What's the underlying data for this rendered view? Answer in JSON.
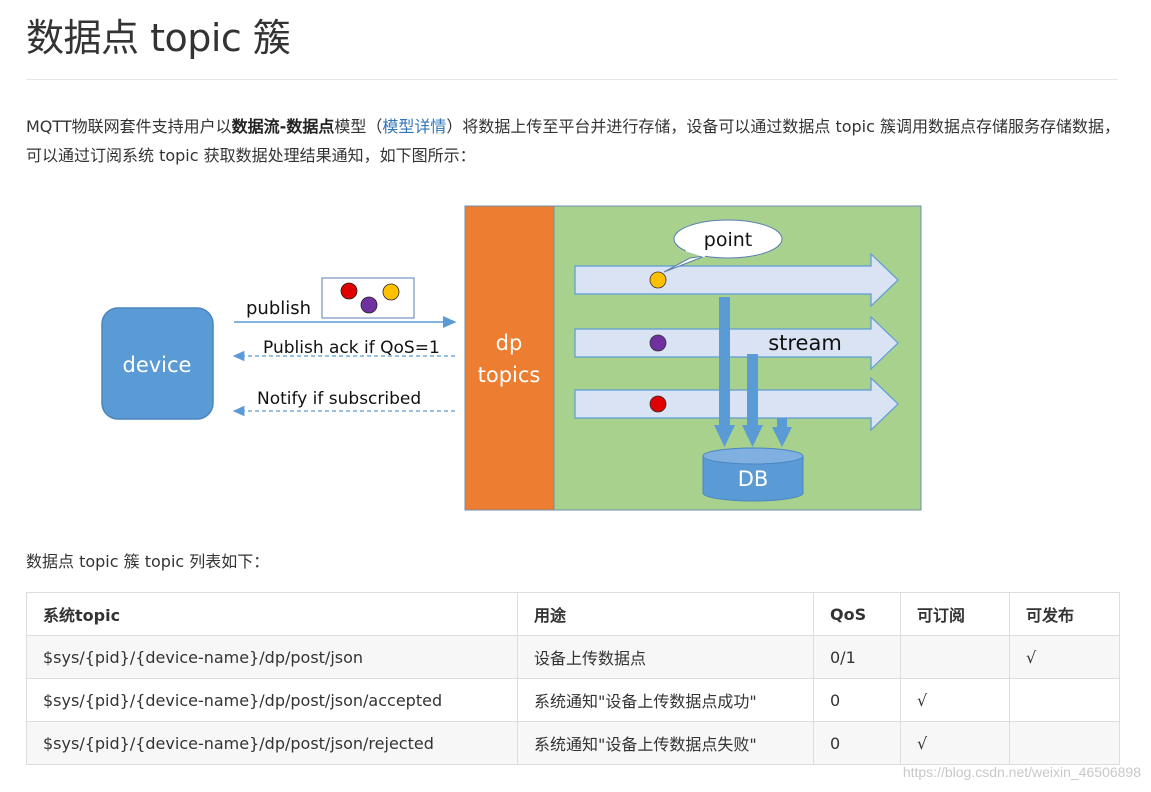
{
  "title": "数据点 topic 簇",
  "intro": {
    "part1": "MQTT物联网套件支持用户以",
    "bold": "数据流-数据点",
    "part2": "模型（",
    "link": "模型详情",
    "part3": "）将数据上传至平台并进行存储，设备可以通过数据点 topic 簇调用数据点存储服务存储数据，可以通过订阅系统 topic 获取数据处理结果通知，如下图所示："
  },
  "diagram": {
    "device_label": "device",
    "publish_label": "publish",
    "ack_label": "Publish ack if QoS=1",
    "notify_label": "Notify if subscribed",
    "dp_line1": "dp",
    "dp_line2": "topics",
    "point_label": "point",
    "stream_label": "stream",
    "db_label": "DB",
    "colors": {
      "device": "#5b9bd5",
      "dp_topics": "#ed7d31",
      "platform_bg": "#a9d18e",
      "stream_fill": "#dae3f3",
      "dot_red": "#e00000",
      "dot_purple": "#7030a0",
      "dot_yellow": "#ffc000"
    }
  },
  "list_caption": "数据点 topic 簇 topic 列表如下：",
  "table": {
    "headers": [
      "系统topic",
      "用途",
      "QoS",
      "可订阅",
      "可发布"
    ],
    "rows": [
      [
        "$sys/{pid}/{device-name}/dp/post/json",
        "设备上传数据点",
        "0/1",
        "",
        "√"
      ],
      [
        "$sys/{pid}/{device-name}/dp/post/json/accepted",
        "系统通知\"设备上传数据点成功\"",
        "0",
        "√",
        ""
      ],
      [
        "$sys/{pid}/{device-name}/dp/post/json/rejected",
        "系统通知\"设备上传数据点失败\"",
        "0",
        "√",
        ""
      ]
    ]
  },
  "watermark": "https://blog.csdn.net/weixin_46506898"
}
